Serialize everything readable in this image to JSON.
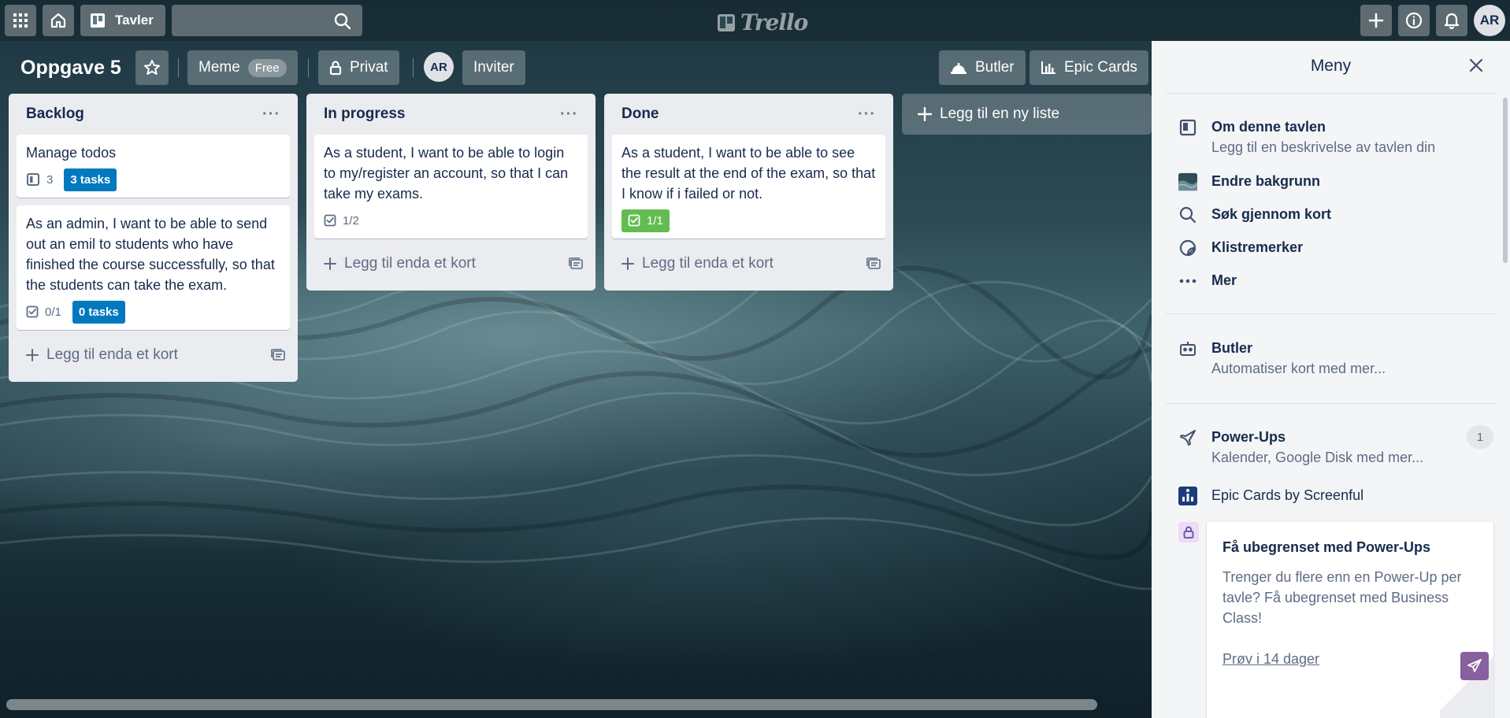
{
  "header": {
    "boards_label": "Tavler",
    "search": {
      "value": "",
      "placeholder": ""
    },
    "logo_text": "Trello",
    "user_initials": "AR"
  },
  "board": {
    "title": "Oppgave 5",
    "workspace_label": "Meme",
    "plan_badge": "Free",
    "visibility_label": "Privat",
    "member_initials": "AR",
    "invite_label": "Inviter",
    "butler_label": "Butler",
    "epic_cards_label": "Epic Cards"
  },
  "lists": [
    {
      "title": "Backlog",
      "menu": "···",
      "cards": [
        {
          "text": "Manage todos",
          "icon_count": "3",
          "tasks_badge": "3 tasks"
        },
        {
          "text": "As an admin, I want to be able to send out an emil to students who have finished the course successfully, so that the students can take the exam.",
          "checklist": "0/1",
          "tasks_badge": "0 tasks"
        }
      ],
      "add_card_label": "Legg til enda et kort"
    },
    {
      "title": "In progress",
      "menu": "···",
      "cards": [
        {
          "text": "As a student, I want to be able to login to my/register an account, so that I can take my exams.",
          "checklist": "1/2"
        }
      ],
      "add_card_label": "Legg til enda et kort"
    },
    {
      "title": "Done",
      "menu": "···",
      "cards": [
        {
          "text": "As a student, I want to be able to see the result at the end of the exam, so that I know if i failed or not.",
          "checklist": "1/1"
        }
      ],
      "add_card_label": "Legg til enda et kort"
    }
  ],
  "add_list_label": "Legg til en ny liste",
  "menu": {
    "title": "Meny",
    "items": [
      {
        "label": "Om denne tavlen",
        "sub": "Legg til en beskrivelse av tavlen din"
      },
      {
        "label": "Endre bakgrunn"
      },
      {
        "label": "Søk gjennom kort"
      },
      {
        "label": "Klistremerker"
      },
      {
        "label": "Mer"
      }
    ],
    "butler": {
      "label": "Butler",
      "sub": "Automatiser kort med mer..."
    },
    "powerups": {
      "label": "Power-Ups",
      "sub": "Kalender, Google Disk med mer...",
      "count": "1"
    },
    "epic_cards": {
      "label": "Epic Cards by Screenful"
    },
    "promo": {
      "title": "Få ubegrenset med Power-Ups",
      "body": "Trenger du flere enn en Power-Up per tavle? Få ubegrenset med Business Class!",
      "link": "Prøv i 14 dager"
    }
  },
  "colors": {
    "card_badge_blue": "#0079bf",
    "card_badge_green": "#61bd4f",
    "promo_accent": "#89609e"
  }
}
